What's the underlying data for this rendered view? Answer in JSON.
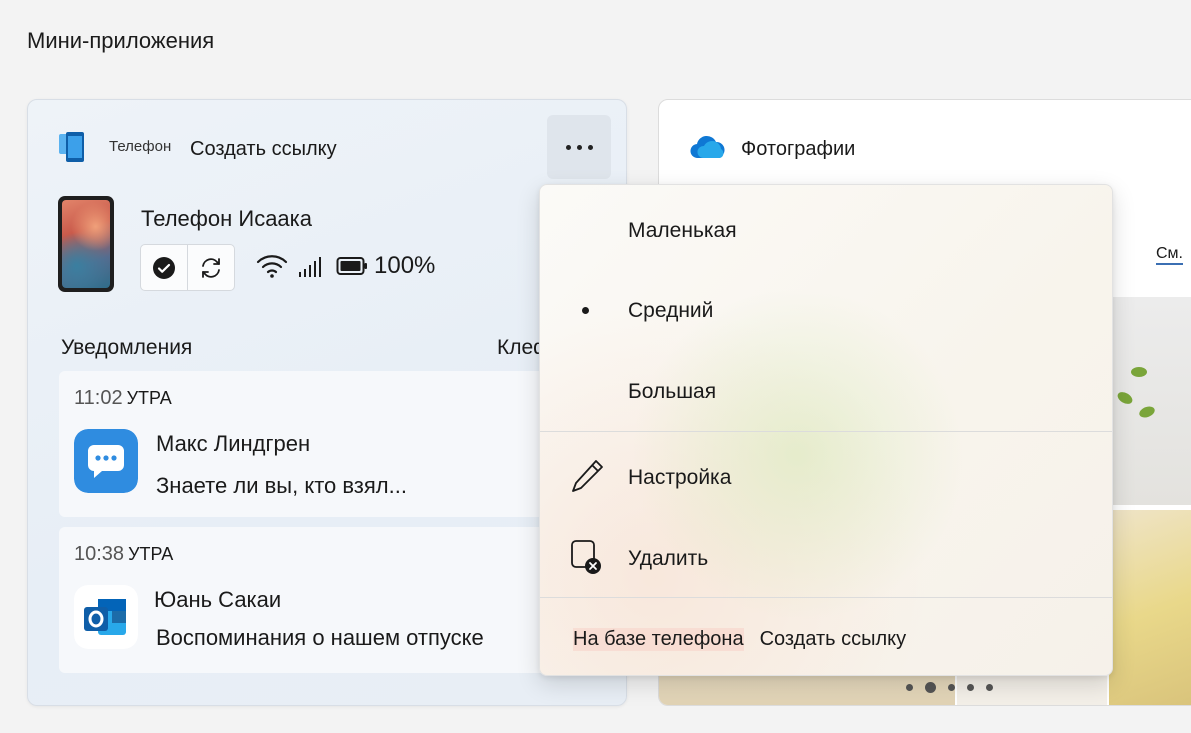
{
  "page": {
    "title": "Мини-приложения"
  },
  "phone_widget": {
    "app_name": "Телефон",
    "link_label": "Создать ссылку",
    "device_name": "Телефон Исаака",
    "battery": "100%",
    "notifications_title": "Уведомления",
    "notifications_clip": "Клеф",
    "notifications": [
      {
        "time": "11:02",
        "ampm": "УТРА",
        "sender": "Макс Линдгрен",
        "message": "Знаете ли вы, кто взял...",
        "app_icon": "messages-icon"
      },
      {
        "time": "10:38",
        "ampm": "УТРА",
        "sender": "Юань Сакаи",
        "message": "Воспоминания о нашем отпуске",
        "app_icon": "outlook-icon"
      }
    ]
  },
  "photos_widget": {
    "title": "Фотографии",
    "see_all": "См.",
    "carousel_pages": 5,
    "carousel_active": 2
  },
  "context_menu": {
    "size_options": [
      {
        "label": "Маленькая",
        "selected": false
      },
      {
        "label": "Средний",
        "selected": true
      },
      {
        "label": "Большая",
        "selected": false
      }
    ],
    "customize_label": "Настройка",
    "remove_label": "Удалить",
    "footer_brand": "На базе телефона",
    "footer_link": "Создать ссылку"
  },
  "colors": {
    "accent": "#0078d4",
    "phone_card_bg": "#e9eff6",
    "menu_bg": "#f8f4ec"
  }
}
